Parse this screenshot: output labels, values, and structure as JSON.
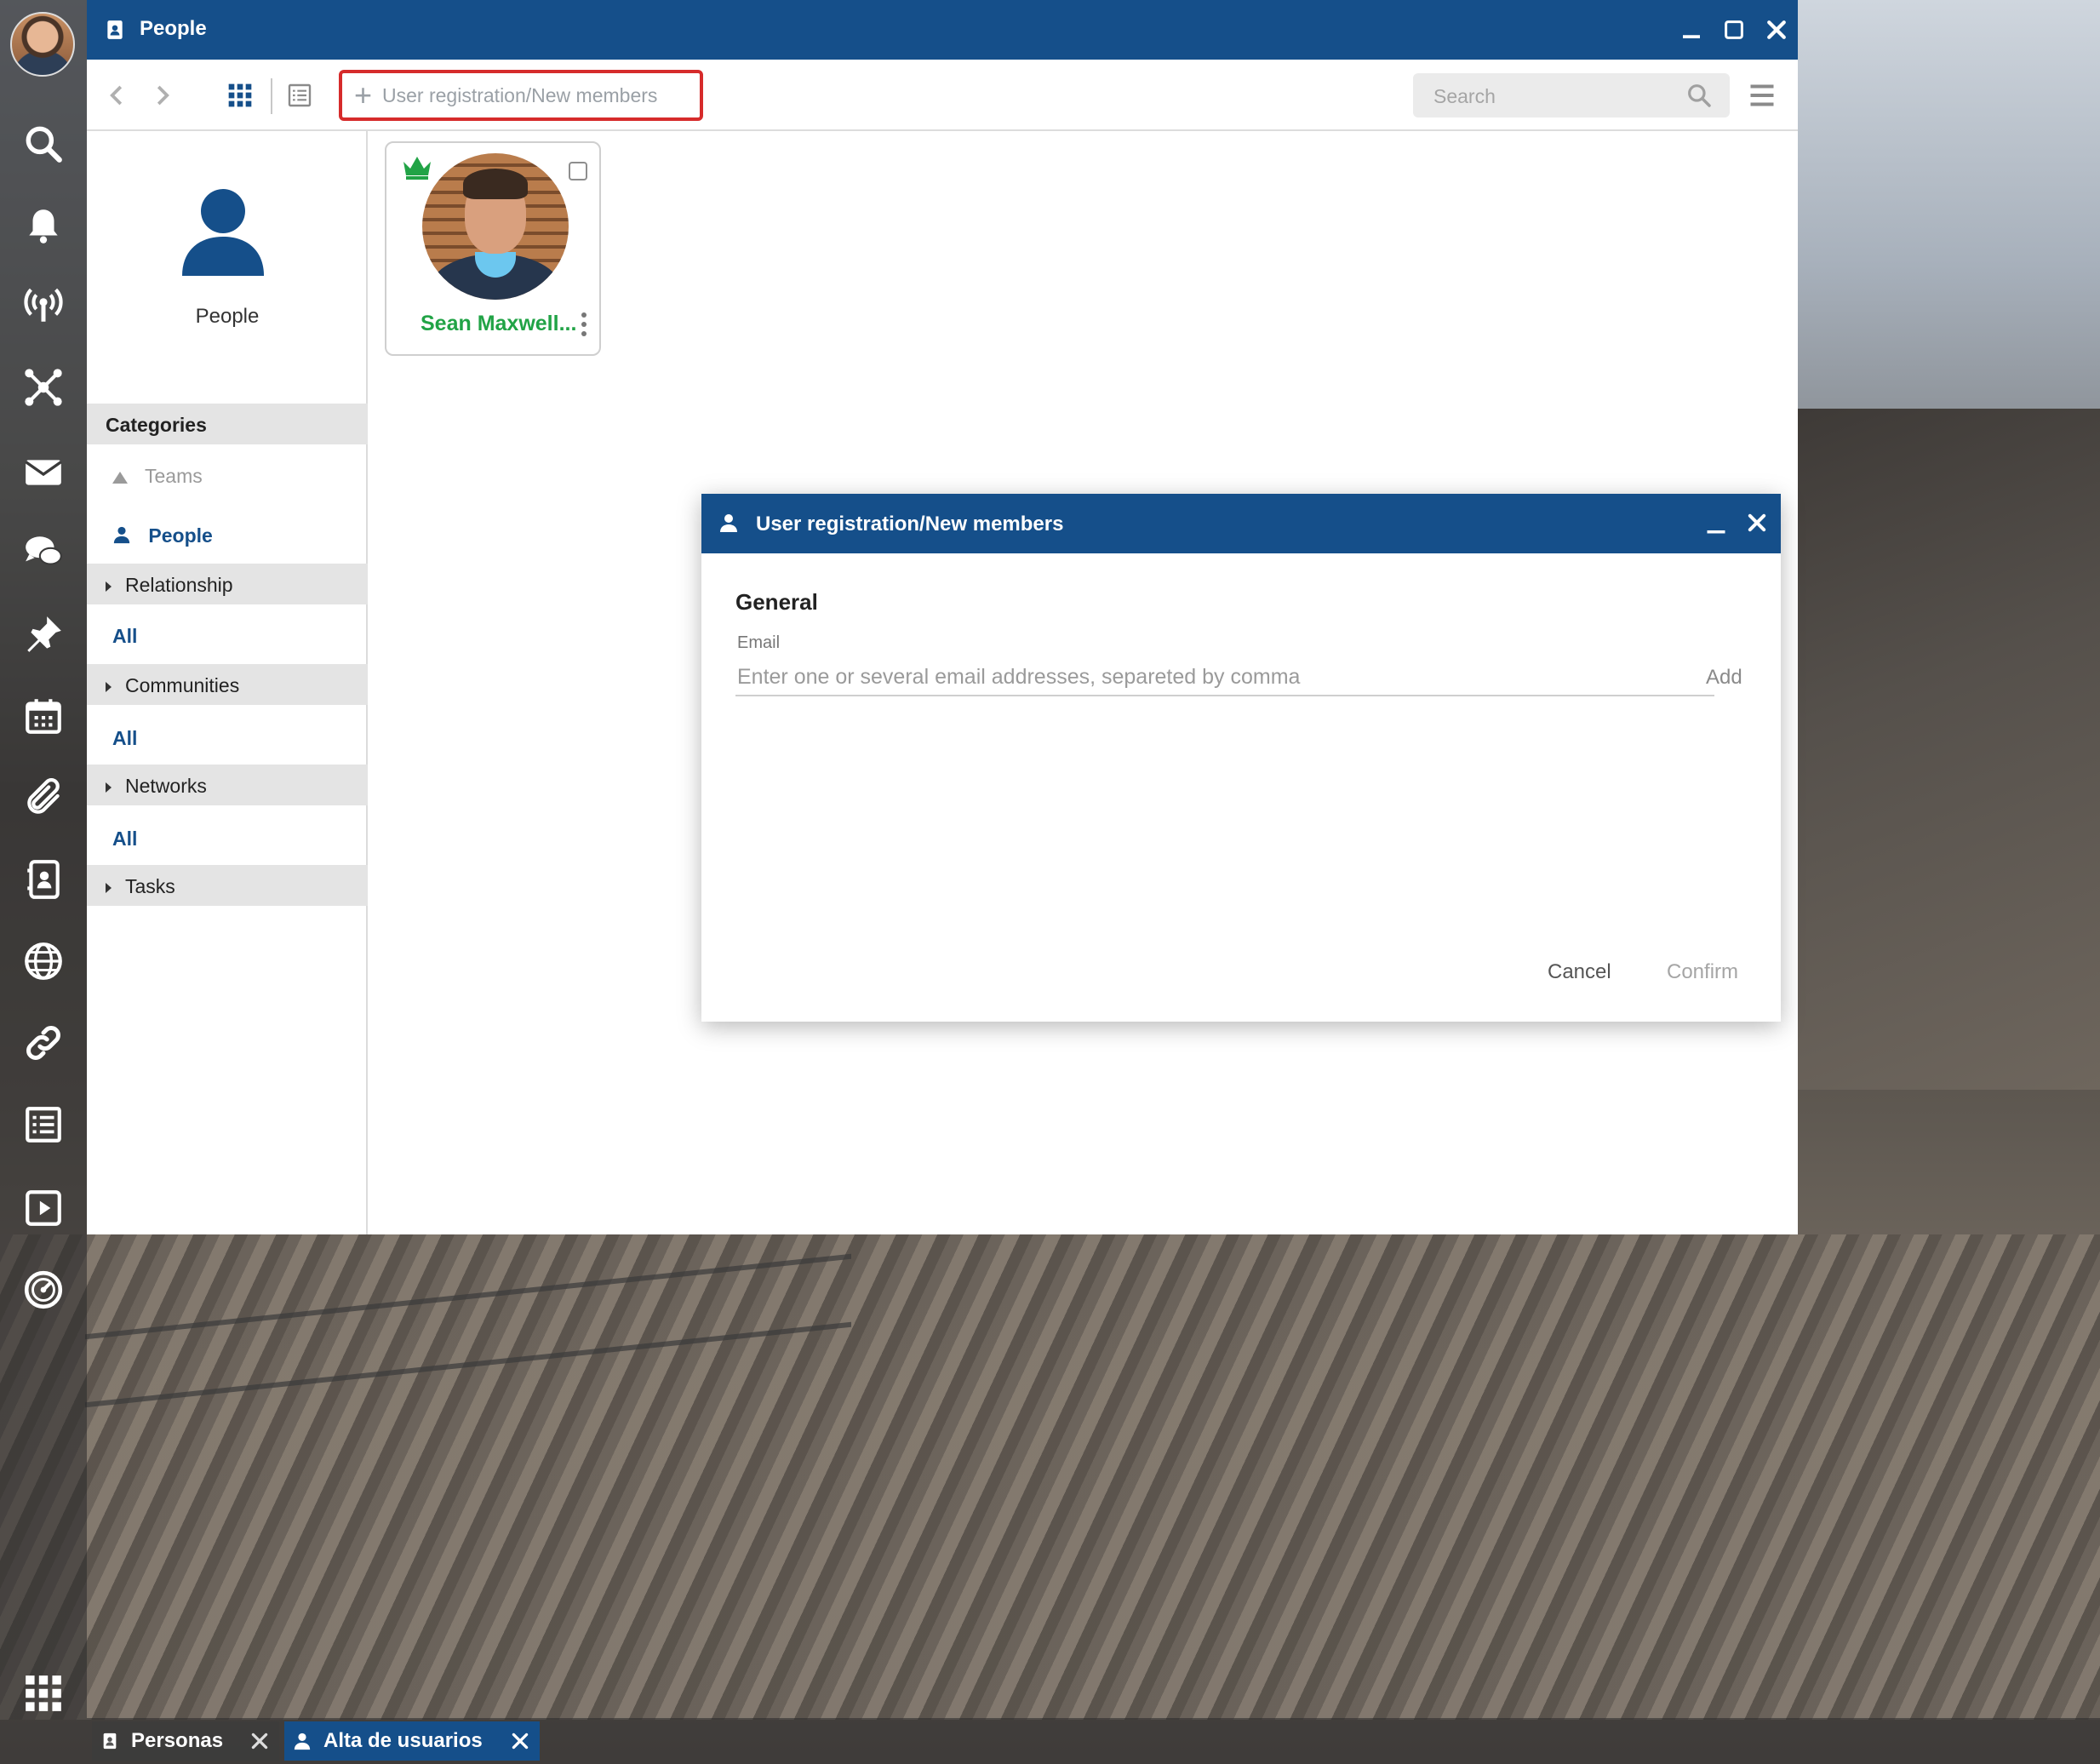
{
  "window": {
    "title": "People"
  },
  "toolbar": {
    "new_members_label": "User registration/New members",
    "search_placeholder": "Search"
  },
  "sidebar": {
    "header_label": "People",
    "categories_label": "Categories",
    "teams_label": "Teams",
    "people_label": "People",
    "groups": [
      {
        "label": "Relationship",
        "all_label": "All"
      },
      {
        "label": "Communities",
        "all_label": "All"
      },
      {
        "label": "Networks",
        "all_label": "All"
      },
      {
        "label": "Tasks"
      }
    ]
  },
  "content": {
    "cards": [
      {
        "name": "Sean Maxwell..."
      }
    ]
  },
  "dialog": {
    "title": "User registration/New members",
    "section_heading": "General",
    "email_label": "Email",
    "email_placeholder": "Enter one or several email addresses, separeted by comma",
    "email_value": "",
    "add_label": "Add",
    "cancel_label": "Cancel",
    "confirm_label": "Confirm"
  },
  "taskbar": {
    "tasks": [
      {
        "label": "Personas"
      },
      {
        "label": "Alta de usuarios"
      }
    ]
  },
  "dock": {
    "icons": [
      "search-icon",
      "bell-icon",
      "broadcast-icon",
      "network-icon",
      "mail-icon",
      "chat-icon",
      "pin-icon",
      "calendar-icon",
      "paperclip-icon",
      "contacts-icon",
      "globe-icon",
      "link-icon",
      "list-icon",
      "play-icon",
      "dashboard-icon",
      "apps-grid-icon"
    ]
  },
  "colors": {
    "brand": "#154f8a",
    "highlight_border": "#d62b2b",
    "name_green": "#21a346"
  }
}
